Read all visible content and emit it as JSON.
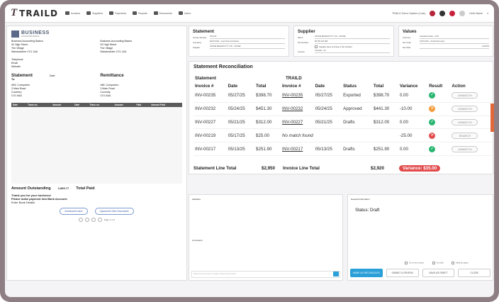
{
  "app": {
    "logo": "TRAILD",
    "logo_mark": "T"
  },
  "nav": [
    "Invoices",
    "Suppliers",
    "Payments",
    "Reports",
    "Documents",
    "Users"
  ],
  "user": {
    "org": "TRAILD Demo System (Lock)",
    "name": "Hello Name"
  },
  "doc": {
    "company": "BUSINESS",
    "tagline": "ACCOUNTING BASICS",
    "from_lines": [
      "Business Accounting Basics",
      "92 High Street",
      "The Village",
      "Warwickshire CV1 1AA"
    ],
    "to_lines": [
      "Business Accounting Basics",
      "92 High Street",
      "The Village",
      "Warwickshire CV1 1AA"
    ],
    "contact": [
      "Telephone",
      "Email",
      "Website"
    ],
    "statement": "Statement",
    "date_label": "Date",
    "remittance": "Remittance",
    "to": "To:",
    "customer": [
      "ABC Computers",
      "3 Main Road",
      "Coventry",
      "CV1 6AA"
    ],
    "table_headers": [
      "Date",
      "Trans no.",
      "Amount",
      "Date",
      "Trans no.",
      "Amount",
      "Paid",
      "Amount Paid"
    ],
    "amount_outstanding": "Amount Outstanding",
    "amount_value": "2,965.77",
    "total_paid": "Total Paid",
    "thanks": [
      "Thank you for your business!",
      "Please make payment into Bank Account:",
      "Enter Bank Details"
    ],
    "btn_download": "Download Invoice",
    "btn_upload": "Upload and View Documents",
    "pager": "Page 1 of 1"
  },
  "statement_card": {
    "title": "Statement",
    "fields": [
      {
        "label": "Invoice Number",
        "value": "INV-123"
      },
      {
        "label": "Company",
        "value": "MATCHING - Input Data Verification"
      },
      {
        "label": "Supplier",
        "value": "OZONE BRANDS PTY LTD - OZONE"
      }
    ]
  },
  "supplier_card": {
    "title": "Supplier",
    "fields": [
      {
        "label": "Name",
        "value": "OZONE BRANDS PTY LTD - OZONE"
      },
      {
        "label": "Tax Number",
        "value": "98 765 432 098"
      },
      {
        "label": "Country",
        "value": "Australia - AU"
      }
    ],
    "checkbox": "Supplier does not have a Tax Number"
  },
  "values_card": {
    "title": "Values",
    "fields": [
      {
        "label": "Currency",
        "value": "Australian Dollar - AUD"
      },
      {
        "label": "Tax Code",
        "value": "GST(AU/P) - Default Domestic"
      },
      {
        "label": "Net Total",
        "value": "2,920.00"
      }
    ]
  },
  "recon": {
    "title": "Statement Reconciliation",
    "left_group": "Statement",
    "right_group": "TRAILD",
    "headers": [
      "Invoice #",
      "Date",
      "Total",
      "Invoice #",
      "Date",
      "Status",
      "Total",
      "Variance",
      "Result",
      "Action"
    ],
    "rows": [
      {
        "s_inv": "INV-00235",
        "s_date": "05/27/25",
        "s_total": "$398.70",
        "t_inv": "INV-00235",
        "t_date": "05/27/25",
        "status": "Exported",
        "t_total": "$398.70",
        "variance": "0.00",
        "result": "ok",
        "result_glyph": "✓",
        "action": "UNMATCH"
      },
      {
        "s_inv": "INV-00232",
        "s_date": "05/24/25",
        "s_total": "$451.30",
        "t_inv": "INV-00232",
        "t_date": "05/24/25",
        "status": "Approved",
        "t_total": "$441.30",
        "variance": "-10.00",
        "result": "warn",
        "result_glyph": "✕",
        "action": "UNMATCH"
      },
      {
        "s_inv": "INV-00227",
        "s_date": "05/21/25",
        "s_total": "$312.00",
        "t_inv": "INV-00227",
        "t_date": "05/21/25",
        "status": "Drafts",
        "t_total": "$312.00",
        "variance": "0.00",
        "result": "ok",
        "result_glyph": "✓",
        "action": "UNMATCH"
      },
      {
        "s_inv": "INV-00219",
        "s_date": "05/17/25",
        "s_total": "$25.00",
        "t_inv": "No match found",
        "t_date": "",
        "status": "",
        "t_total": "",
        "variance": "-25.00",
        "result": "bad",
        "result_glyph": "✕",
        "action": "SEARCH"
      },
      {
        "s_inv": "INV-00217",
        "s_date": "05/13/25",
        "s_total": "$251.90",
        "t_inv": "INV-00217",
        "t_date": "05/13/25",
        "status": "Drafts",
        "t_total": "$251.90",
        "variance": "0.00",
        "result": "ok",
        "result_glyph": "✓",
        "action": "UNMATCH"
      }
    ],
    "statement_total_label": "Statement Line Total",
    "statement_total": "$2,950",
    "invoice_total_label": "Invoice Line Total",
    "invoice_total": "$2,920",
    "variance_badge": "Variance: $35.00"
  },
  "activities": {
    "title": "Activities",
    "comments": "Comments",
    "placeholder": "Add comment to log or mention using the @ symbol"
  },
  "general": {
    "title": "General Information",
    "status": "Status: Draft",
    "checks": [
      "Go to next Invoice",
      "On Hold",
      "Mark as urgent"
    ]
  },
  "buttons": {
    "reconcile": "MARK AS RECONCILED",
    "submit": "SUBMIT & REVIEW",
    "draft": "SAVE AS DRAFT",
    "close": "CLOSE"
  },
  "colors": {
    "accent": "#2a9fd8",
    "ok": "#2bb673",
    "warn": "#f39c3d",
    "bad": "#e24c4c",
    "frame": "#8e7f84"
  }
}
